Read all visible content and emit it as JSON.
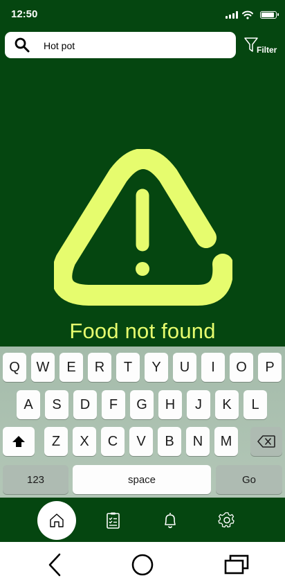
{
  "status_bar": {
    "time": "12:50"
  },
  "search": {
    "value": "Hot pot"
  },
  "filter": {
    "label": "Filter"
  },
  "empty_state": {
    "message": "Food not found"
  },
  "keyboard": {
    "row1": [
      "Q",
      "W",
      "E",
      "R",
      "T",
      "Y",
      "U",
      "I",
      "O",
      "P"
    ],
    "row2": [
      "A",
      "S",
      "D",
      "F",
      "G",
      "H",
      "J",
      "K",
      "L"
    ],
    "row3": [
      "Z",
      "X",
      "C",
      "V",
      "B",
      "N",
      "M"
    ],
    "numbers_label": "123",
    "space_label": "space",
    "go_label": "Go"
  },
  "bottom_nav": {
    "items": [
      "home-icon",
      "list-icon",
      "bell-icon",
      "gear-icon"
    ],
    "active": "home-icon"
  },
  "colors": {
    "background": "#054610",
    "accent": "#e6fc6e",
    "keyboard": "#a4bbaa"
  }
}
